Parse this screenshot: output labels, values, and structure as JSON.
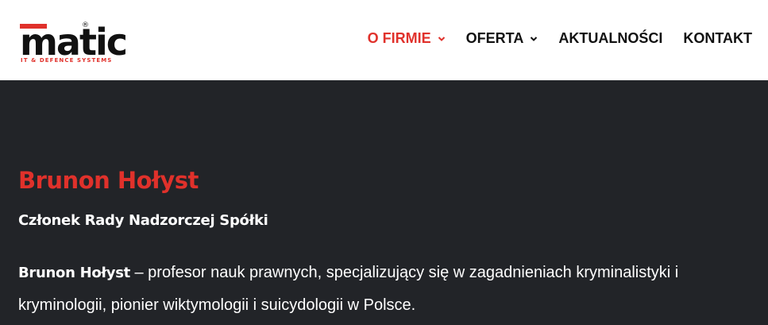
{
  "brand": {
    "logo_text": "matic",
    "tagline": "IT & DEFENCE SYSTEMS",
    "registered_mark": "®",
    "accent_color": "#e0312b"
  },
  "nav": {
    "items": [
      {
        "label": "O FIRMIE",
        "active": true,
        "has_dropdown": true
      },
      {
        "label": "OFERTA",
        "active": false,
        "has_dropdown": true
      },
      {
        "label": "AKTUALNOŚCI",
        "active": false,
        "has_dropdown": false
      },
      {
        "label": "KONTAKT",
        "active": false,
        "has_dropdown": false
      }
    ]
  },
  "profile": {
    "name": "Brunon Hołyst",
    "role": "Członek Rady Nadzorczej Spółki",
    "bio_name": "Brunon Hołyst",
    "bio_text": " – profesor nauk prawnych, specjalizujący się w zagadnieniach kryminalistyki i kryminologii, pionier wiktymologii i suicydologii w Polsce."
  },
  "colors": {
    "header_bg": "#ffffff",
    "content_bg": "#222428",
    "nav_text": "#111111"
  }
}
